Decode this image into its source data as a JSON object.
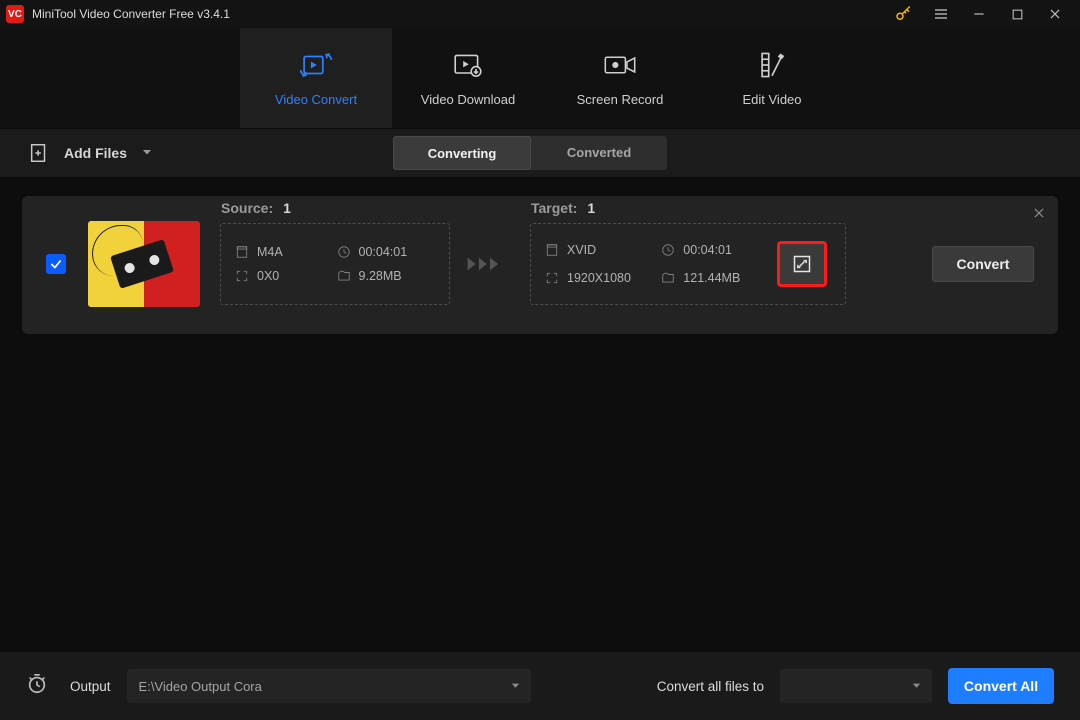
{
  "app": {
    "title": "MiniTool Video Converter Free v3.4.1",
    "logo_text": "VC"
  },
  "tabs": {
    "convert": "Video Convert",
    "download": "Video Download",
    "record": "Screen Record",
    "edit": "Edit Video"
  },
  "toolbar": {
    "add_files": "Add Files",
    "converting": "Converting",
    "converted": "Converted"
  },
  "item": {
    "source_label": "Source:",
    "source_count": "1",
    "target_label": "Target:",
    "target_count": "1",
    "src": {
      "format": "M4A",
      "duration": "00:04:01",
      "resolution": "0X0",
      "size": "9.28MB"
    },
    "tgt": {
      "format": "XVID",
      "duration": "00:04:01",
      "resolution": "1920X1080",
      "size": "121.44MB"
    },
    "convert_btn": "Convert"
  },
  "footer": {
    "output_label": "Output",
    "output_path": "E:\\Video Output Cora",
    "convert_to_label": "Convert all files to",
    "format_selected": "",
    "convert_all": "Convert All"
  }
}
